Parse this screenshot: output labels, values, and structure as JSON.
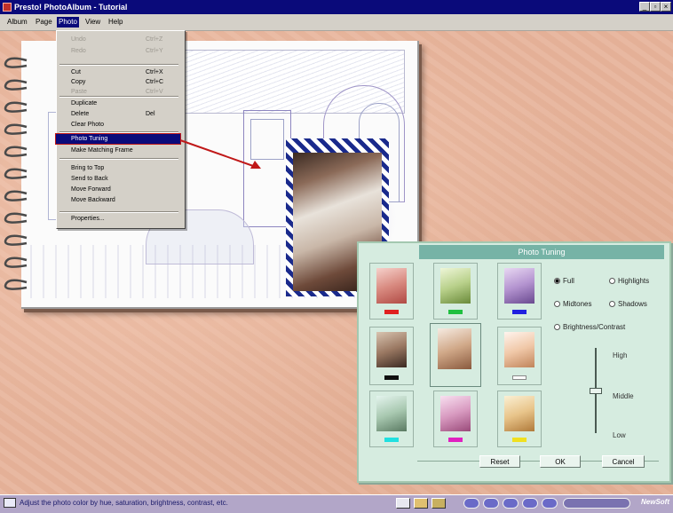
{
  "window": {
    "title": "Presto! PhotoAlbum - Tutorial",
    "min": "_",
    "restore": "▫",
    "close": "×"
  },
  "menubar": {
    "items": [
      "Album",
      "Page",
      "Photo",
      "View",
      "Help"
    ]
  },
  "photo_menu": {
    "items": [
      {
        "label": "Undo",
        "shortcut": "Ctrl+Z",
        "disabled": true
      },
      {
        "label": "Redo",
        "shortcut": "Ctrl+Y",
        "disabled": true
      },
      {
        "label": "Cut",
        "shortcut": "Ctrl+X",
        "disabled": false
      },
      {
        "label": "Copy",
        "shortcut": "Ctrl+C",
        "disabled": false
      },
      {
        "label": "Paste",
        "shortcut": "Ctrl+V",
        "disabled": true
      },
      {
        "label": "Duplicate",
        "shortcut": "",
        "disabled": false
      },
      {
        "label": "Delete",
        "shortcut": "Del",
        "disabled": false
      },
      {
        "label": "Clear Photo",
        "shortcut": "",
        "disabled": false
      },
      {
        "label": "Photo Tuning",
        "shortcut": "",
        "disabled": false,
        "highlighted": true
      },
      {
        "label": "Make Matching Frame",
        "shortcut": "",
        "disabled": false
      },
      {
        "label": "Bring to Top",
        "shortcut": "",
        "disabled": false
      },
      {
        "label": "Send to Back",
        "shortcut": "",
        "disabled": false
      },
      {
        "label": "Move Forward",
        "shortcut": "",
        "disabled": false
      },
      {
        "label": "Move Backward",
        "shortcut": "",
        "disabled": false
      },
      {
        "label": "Properties...",
        "shortcut": "",
        "disabled": false
      }
    ]
  },
  "dialog": {
    "title": "Photo Tuning",
    "options": [
      {
        "label": "Full",
        "selected": true
      },
      {
        "label": "Highlights",
        "selected": false
      },
      {
        "label": "Midtones",
        "selected": false
      },
      {
        "label": "Shadows",
        "selected": false
      },
      {
        "label": "Brightness/Contrast",
        "selected": false
      }
    ],
    "slider": {
      "high": "High",
      "middle": "Middle",
      "low": "Low",
      "level": 0.5
    },
    "swatches": [
      "#e02020",
      "#20c040",
      "#2020e0",
      "#101010",
      "#ffffff",
      "#20e0e0",
      "#e020c0",
      "#f0e020"
    ],
    "buttons": {
      "reset": "Reset",
      "ok": "OK",
      "cancel": "Cancel"
    }
  },
  "statusbar": {
    "text": "Adjust the photo color by hue, saturation, brightness, contrast, etc.",
    "brand": "NewSoft"
  }
}
